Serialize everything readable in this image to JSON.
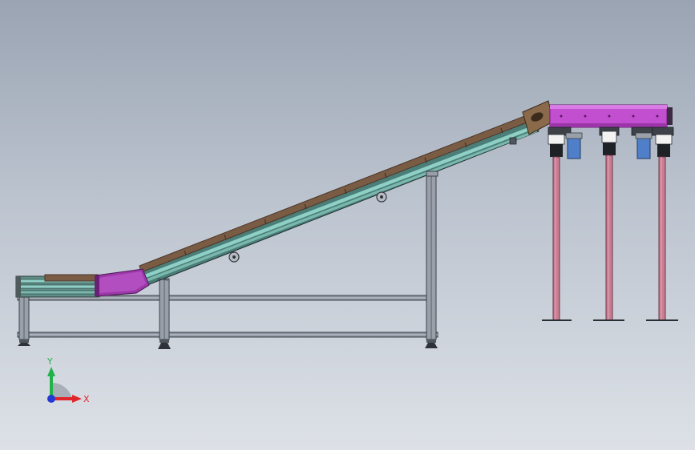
{
  "view": {
    "background_top": "#9aa4b3",
    "background_bottom": "#dde1e7"
  },
  "colors": {
    "frame": "#8d939e",
    "frame_dark": "#3b4048",
    "belt": "#7a5c44",
    "belt_edge": "#4a3528",
    "rail": "#3f8f88",
    "rail_light": "#8fd0c6",
    "housing": "#c24fd0",
    "housing_dark": "#7a2380",
    "leg_pink": "#c87d92",
    "motor_blue": "#4f7fc8"
  },
  "triad": {
    "x_label": "X",
    "y_label": "Y",
    "x_color": "#e0262a",
    "y_color": "#22b24a",
    "z_color": "#2438d4"
  }
}
